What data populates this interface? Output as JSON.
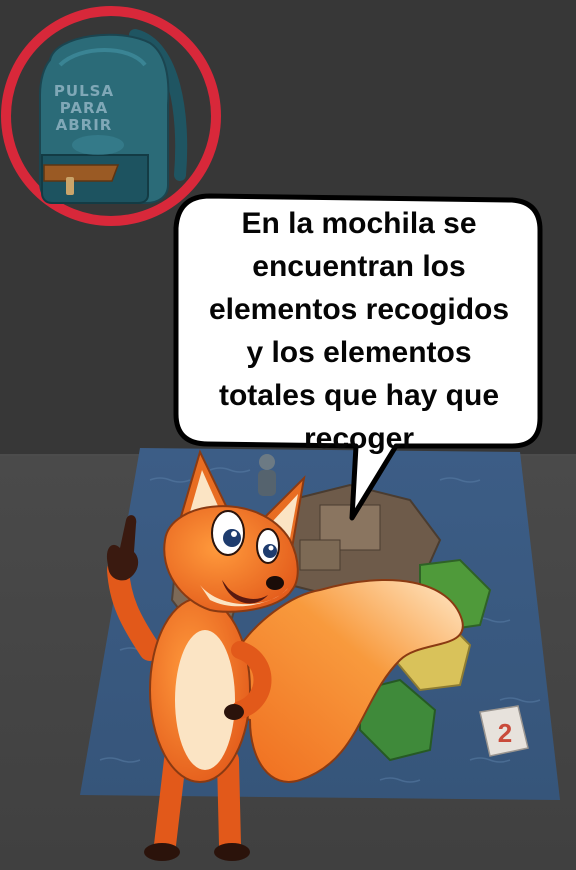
{
  "backpack": {
    "label": "PULSA\nPARA\nABRIR",
    "ring_color": "#d8283a",
    "bag_color": "#2b6b78"
  },
  "speech_bubble": {
    "text": "En la mochila se\nencuentran los\nelementos recogidos\ny los elementos\ntotales que hay que\nrecoger"
  },
  "board": {
    "tile_number": "2"
  },
  "mascot": {
    "icon": "fox-mascot"
  }
}
